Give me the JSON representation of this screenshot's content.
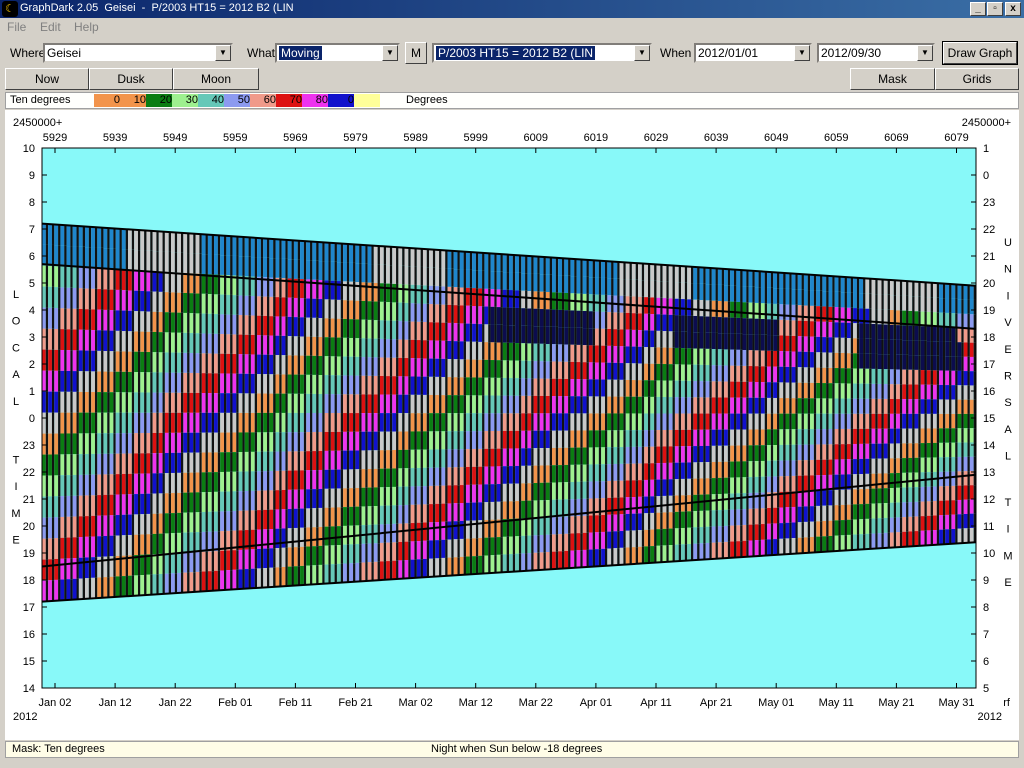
{
  "window": {
    "title": "GraphDark 2.05  Geisei  -  P/2003 HT15 = 2012 B2 (LIN",
    "minimize": "_",
    "restore": "▫",
    "close": "x"
  },
  "menu": [
    {
      "label": "File"
    },
    {
      "label": "Edit"
    },
    {
      "label": "Help"
    }
  ],
  "toolbar": {
    "where_label": "Where",
    "where_value": "Geisei",
    "what_label": "What",
    "what_value": "Moving",
    "m_button": "M",
    "object_value": "P/2003 HT15 = 2012 B2 (LIN",
    "when_label": "When",
    "start_date": "2012/01/01",
    "end_date": "2012/09/30",
    "draw_button": "Draw Graph"
  },
  "buttons": {
    "now": "Now",
    "dusk": "Dusk",
    "moon": "Moon",
    "mask": "Mask",
    "grids": "Grids"
  },
  "legend": {
    "label": "Ten degrees",
    "unit": "Degrees",
    "entries": [
      {
        "label": "0",
        "color": "#f2944b"
      },
      {
        "label": "10",
        "color": "#f2944b"
      },
      {
        "label": "20",
        "color": "#0b7d12"
      },
      {
        "label": "30",
        "color": "#9ef08f"
      },
      {
        "label": "40",
        "color": "#66c8b8"
      },
      {
        "label": "50",
        "color": "#8c9af0"
      },
      {
        "label": "60",
        "color": "#f09a8a"
      },
      {
        "label": "70",
        "color": "#dd1111"
      },
      {
        "label": "80",
        "color": "#ee33ee"
      },
      {
        "label": "0",
        "color": "#1111cc"
      },
      {
        "label": "",
        "color": "#ffff99"
      }
    ]
  },
  "chart_data": {
    "type": "heatmap",
    "background_color": "#88f9f9",
    "jd_prefix": "2450000+",
    "jd_ticks": [
      "5929",
      "5939",
      "5949",
      "5959",
      "5969",
      "5979",
      "5989",
      "5999",
      "6009",
      "6019",
      "6029",
      "6039",
      "6049",
      "6059",
      "6069",
      "6079"
    ],
    "date_ticks": [
      "Jan 02",
      "Jan 12",
      "Jan 22",
      "Feb 01",
      "Feb 11",
      "Feb 21",
      "Mar 02",
      "Mar 12",
      "Mar 22",
      "Apr 01",
      "Apr 11",
      "Apr 21",
      "May 01",
      "May 11",
      "May 21",
      "May 31"
    ],
    "year_left": "2012",
    "year_right": "2012",
    "right_corner": "rf",
    "left_axis_ticks": [
      "10",
      "9",
      "8",
      "7",
      "6",
      "5",
      "4",
      "3",
      "2",
      "1",
      "0",
      "23",
      "22",
      "21",
      "20",
      "19",
      "18",
      "17",
      "16",
      "15",
      "14"
    ],
    "right_axis_ticks": [
      "1",
      "0",
      "23",
      "22",
      "21",
      "20",
      "19",
      "18",
      "17",
      "16",
      "15",
      "14",
      "13",
      "12",
      "11",
      "10",
      "9",
      "8",
      "7",
      "6",
      "5"
    ],
    "left_axis_title": "LOCAL TIME",
    "right_axis_title_top": "UNIVERSAL",
    "right_axis_title_bottom": "TIME",
    "dark_night_color": "#0c0c4e",
    "twilight_color": "#1f86cc",
    "altitude_colors": [
      "#f2944b",
      "#0b7d12",
      "#9ef08f",
      "#66c8b8",
      "#8c9af0",
      "#f09a8a",
      "#dd1111",
      "#ee33ee",
      "#1111cc",
      "#c9c9c9"
    ],
    "days": 152,
    "curves": {
      "dusk_end": {
        "start": 7.2,
        "end": 4.9
      },
      "dawn_start": {
        "start": -6.8,
        "end": -4.6
      },
      "moon_set": {
        "start": 5.7,
        "end": 3.3
      },
      "rise_line": {
        "start": -5.5,
        "end": -2.1
      }
    }
  },
  "status": {
    "mask": "Mask:  Ten degrees",
    "night": "Night when Sun below -18 degrees"
  }
}
